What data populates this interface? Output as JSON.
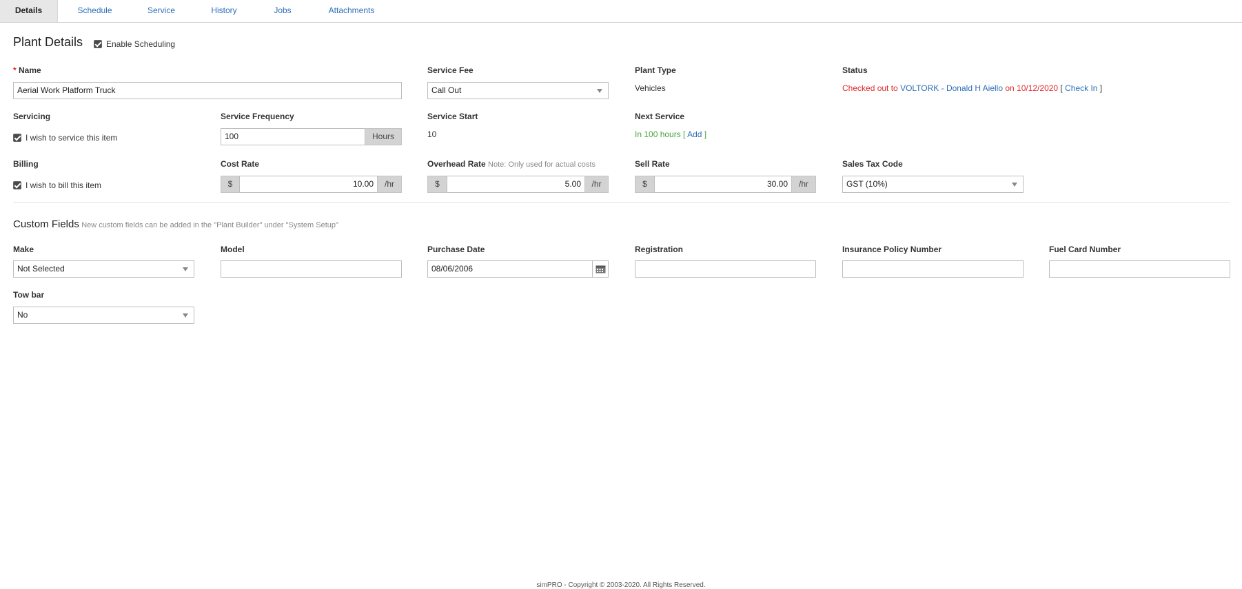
{
  "tabs": [
    "Details",
    "Schedule",
    "Service",
    "History",
    "Jobs",
    "Attachments"
  ],
  "section1": {
    "title": "Plant Details",
    "enable_scheduling_label": "Enable Scheduling"
  },
  "name": {
    "label": "Name",
    "required_mark": "*",
    "value": "Aerial Work Platform Truck"
  },
  "service_fee": {
    "label": "Service Fee",
    "value": "Call Out"
  },
  "plant_type": {
    "label": "Plant Type",
    "value": "Vehicles"
  },
  "status": {
    "label": "Status",
    "prefix": "Checked out to ",
    "person": "VOLTORK - Donald H Aiello",
    "date_text": " on 10/12/2020",
    "bracket_open": " [ ",
    "action": "Check In",
    "bracket_close": " ]"
  },
  "servicing": {
    "label": "Servicing",
    "checkbox_label": "I wish to service this item"
  },
  "service_frequency": {
    "label": "Service Frequency",
    "value": "100",
    "unit": "Hours"
  },
  "service_start": {
    "label": "Service Start",
    "value": "10"
  },
  "next_service": {
    "label": "Next Service",
    "text": "In 100 hours",
    "bracket_open": " [ ",
    "action": "Add",
    "bracket_close": " ]"
  },
  "billing": {
    "label": "Billing",
    "checkbox_label": "I wish to bill this item"
  },
  "cost_rate": {
    "label": "Cost Rate",
    "currency": "$",
    "value": "10.00",
    "unit": "/hr"
  },
  "overhead_rate": {
    "label": "Overhead Rate",
    "note": "Note: Only used for actual costs",
    "currency": "$",
    "value": "5.00",
    "unit": "/hr"
  },
  "sell_rate": {
    "label": "Sell Rate",
    "currency": "$",
    "value": "30.00",
    "unit": "/hr"
  },
  "sales_tax": {
    "label": "Sales Tax Code",
    "value": "GST (10%)"
  },
  "custom_fields": {
    "title": "Custom Fields",
    "note": "New custom fields can be added in the \"Plant Builder\" under \"System Setup\"",
    "make": {
      "label": "Make",
      "value": "Not Selected"
    },
    "model": {
      "label": "Model",
      "value": ""
    },
    "purchase_date": {
      "label": "Purchase Date",
      "value": "08/06/2006"
    },
    "registration": {
      "label": "Registration",
      "value": ""
    },
    "insurance": {
      "label": "Insurance Policy Number",
      "value": ""
    },
    "fuel_card": {
      "label": "Fuel Card Number",
      "value": ""
    },
    "tow_bar": {
      "label": "Tow bar",
      "value": "No"
    }
  },
  "footer": "simPRO - Copyright © 2003-2020. All Rights Reserved.",
  "colors": {
    "link": "#2e6fb8",
    "status_red": "#e02b2b",
    "next_green": "#4aa53b"
  }
}
